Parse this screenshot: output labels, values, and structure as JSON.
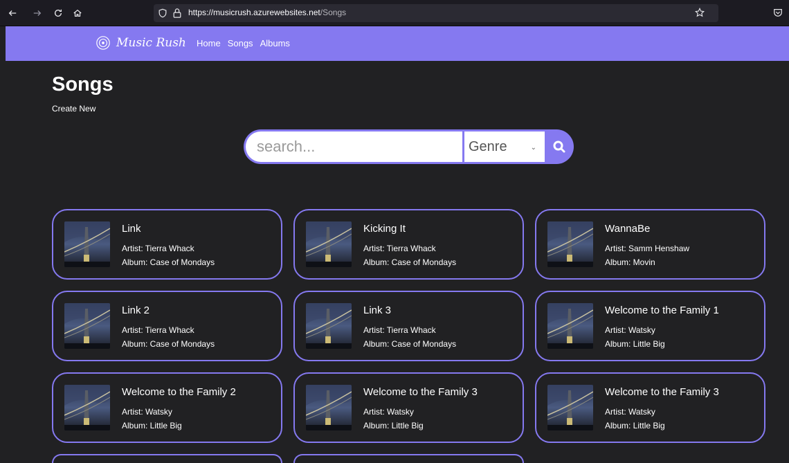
{
  "browser": {
    "url_host": "https://musicrush.azurewebsites.net",
    "url_path": "/Songs"
  },
  "site": {
    "brand": "Music Rush",
    "nav": [
      "Home",
      "Songs",
      "Albums"
    ],
    "brand_color": "#8579f0"
  },
  "page": {
    "title": "Songs",
    "create_new": "Create New"
  },
  "search": {
    "placeholder": "search...",
    "genre_selected": "Genre"
  },
  "songs": [
    {
      "title": "Link",
      "artist": "Artist: Tierra Whack",
      "album": "Album: Case of Mondays"
    },
    {
      "title": "Kicking It",
      "artist": "Artist: Tierra Whack",
      "album": "Album: Case of Mondays"
    },
    {
      "title": "WannaBe",
      "artist": "Artist: Samm Henshaw",
      "album": "Album: Movin"
    },
    {
      "title": "Link 2",
      "artist": "Artist: Tierra Whack",
      "album": "Album: Case of Mondays"
    },
    {
      "title": "Link 3",
      "artist": "Artist: Tierra Whack",
      "album": "Album: Case of Mondays"
    },
    {
      "title": "Welcome to the Family 1",
      "artist": "Artist: Watsky",
      "album": "Album: Little Big"
    },
    {
      "title": "Welcome to the Family 2",
      "artist": "Artist: Watsky",
      "album": "Album: Little Big"
    },
    {
      "title": "Welcome to the Family 3",
      "artist": "Artist: Watsky",
      "album": "Album: Little Big"
    },
    {
      "title": "Welcome to the Family 3",
      "artist": "Artist: Watsky",
      "album": "Album: Little Big"
    }
  ]
}
